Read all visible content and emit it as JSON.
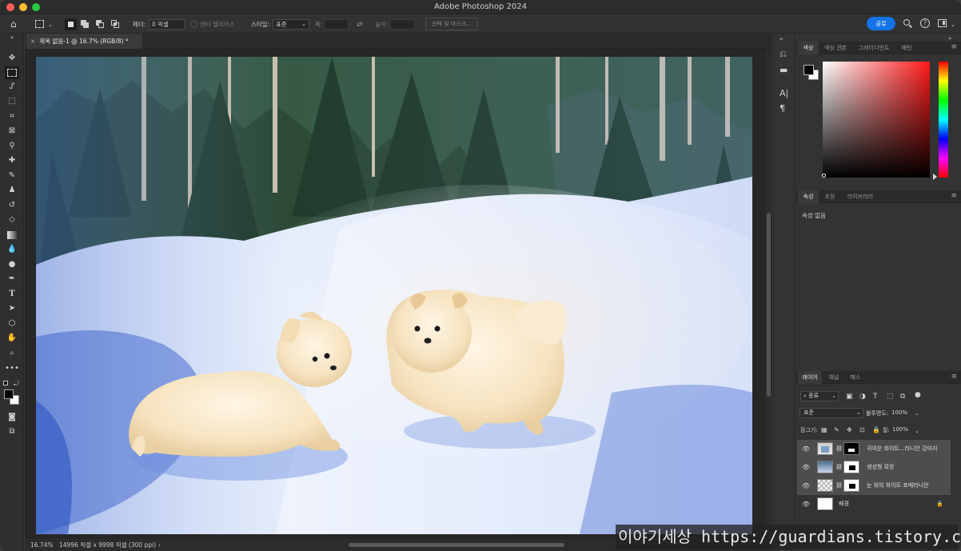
{
  "window": {
    "title": "Adobe Photoshop 2024"
  },
  "options_bar": {
    "feather_label": "페더:",
    "feather_value": "0 픽셀",
    "antialias_label": "앤티 앨리어스",
    "style_label": "스타일:",
    "style_value": "표준",
    "width_label": "폭:",
    "height_label": "높이:",
    "select_mask_button": "선택 및 마스크...",
    "share_button": "공유"
  },
  "document": {
    "tab_title": "제목 없음-1 @ 16.7% (RGB/8) *"
  },
  "status": {
    "zoom": "16.74%",
    "doc_info": "14996 픽셀 x 9998 픽셀 (300 ppi)"
  },
  "color_panel": {
    "tabs": [
      "색상",
      "색상 견본",
      "그레이디언트",
      "패턴"
    ],
    "active_tab": "색상",
    "foreground_color": "#000000",
    "background_color": "#ffffff",
    "hue_color": "#ff1a1a"
  },
  "properties_panel": {
    "tabs": [
      "속성",
      "조정",
      "라이브러리"
    ],
    "active_tab": "속성",
    "empty_text": "속성 없음"
  },
  "layers_panel": {
    "tabs": [
      "레이어",
      "채널",
      "패스"
    ],
    "active_tab": "레이어",
    "filter_kind": "종류",
    "blend_mode": "표준",
    "opacity_label": "불투명도:",
    "opacity_value": "100%",
    "lock_label": "잠그기:",
    "fill_label": "칠:",
    "fill_value": "100%",
    "layers": [
      {
        "name": "귀여운 화이트...라니안 강아지",
        "selected": true,
        "has_mask": true
      },
      {
        "name": "생성형 확장",
        "selected": true,
        "has_mask": true
      },
      {
        "name": "눈 위의 화이트 포메라니안",
        "selected": true,
        "has_mask": true
      },
      {
        "name": "배경",
        "selected": false,
        "has_mask": false,
        "locked": true
      }
    ]
  },
  "watermark": {
    "text": "이야기세상 https://guardians.tistory.com"
  }
}
